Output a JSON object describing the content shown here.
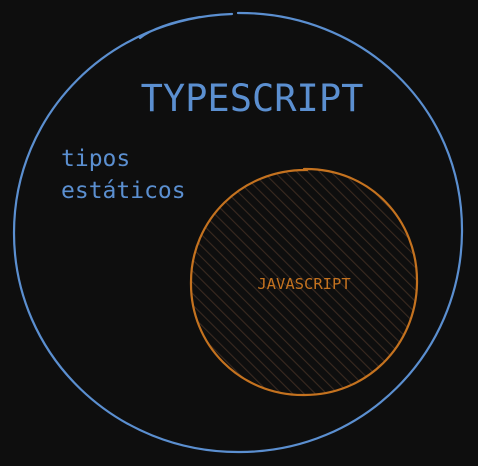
{
  "colors": {
    "background": "#0e0e0e",
    "typescript": "#5b8fd0",
    "javascript": "#c4721f",
    "hatch": "#3a2a20"
  },
  "typescript": {
    "title": "TYPESCRIPT",
    "note_line1": "tipos",
    "note_line2": "estáticos"
  },
  "javascript": {
    "title": "JAVASCRIPT"
  }
}
